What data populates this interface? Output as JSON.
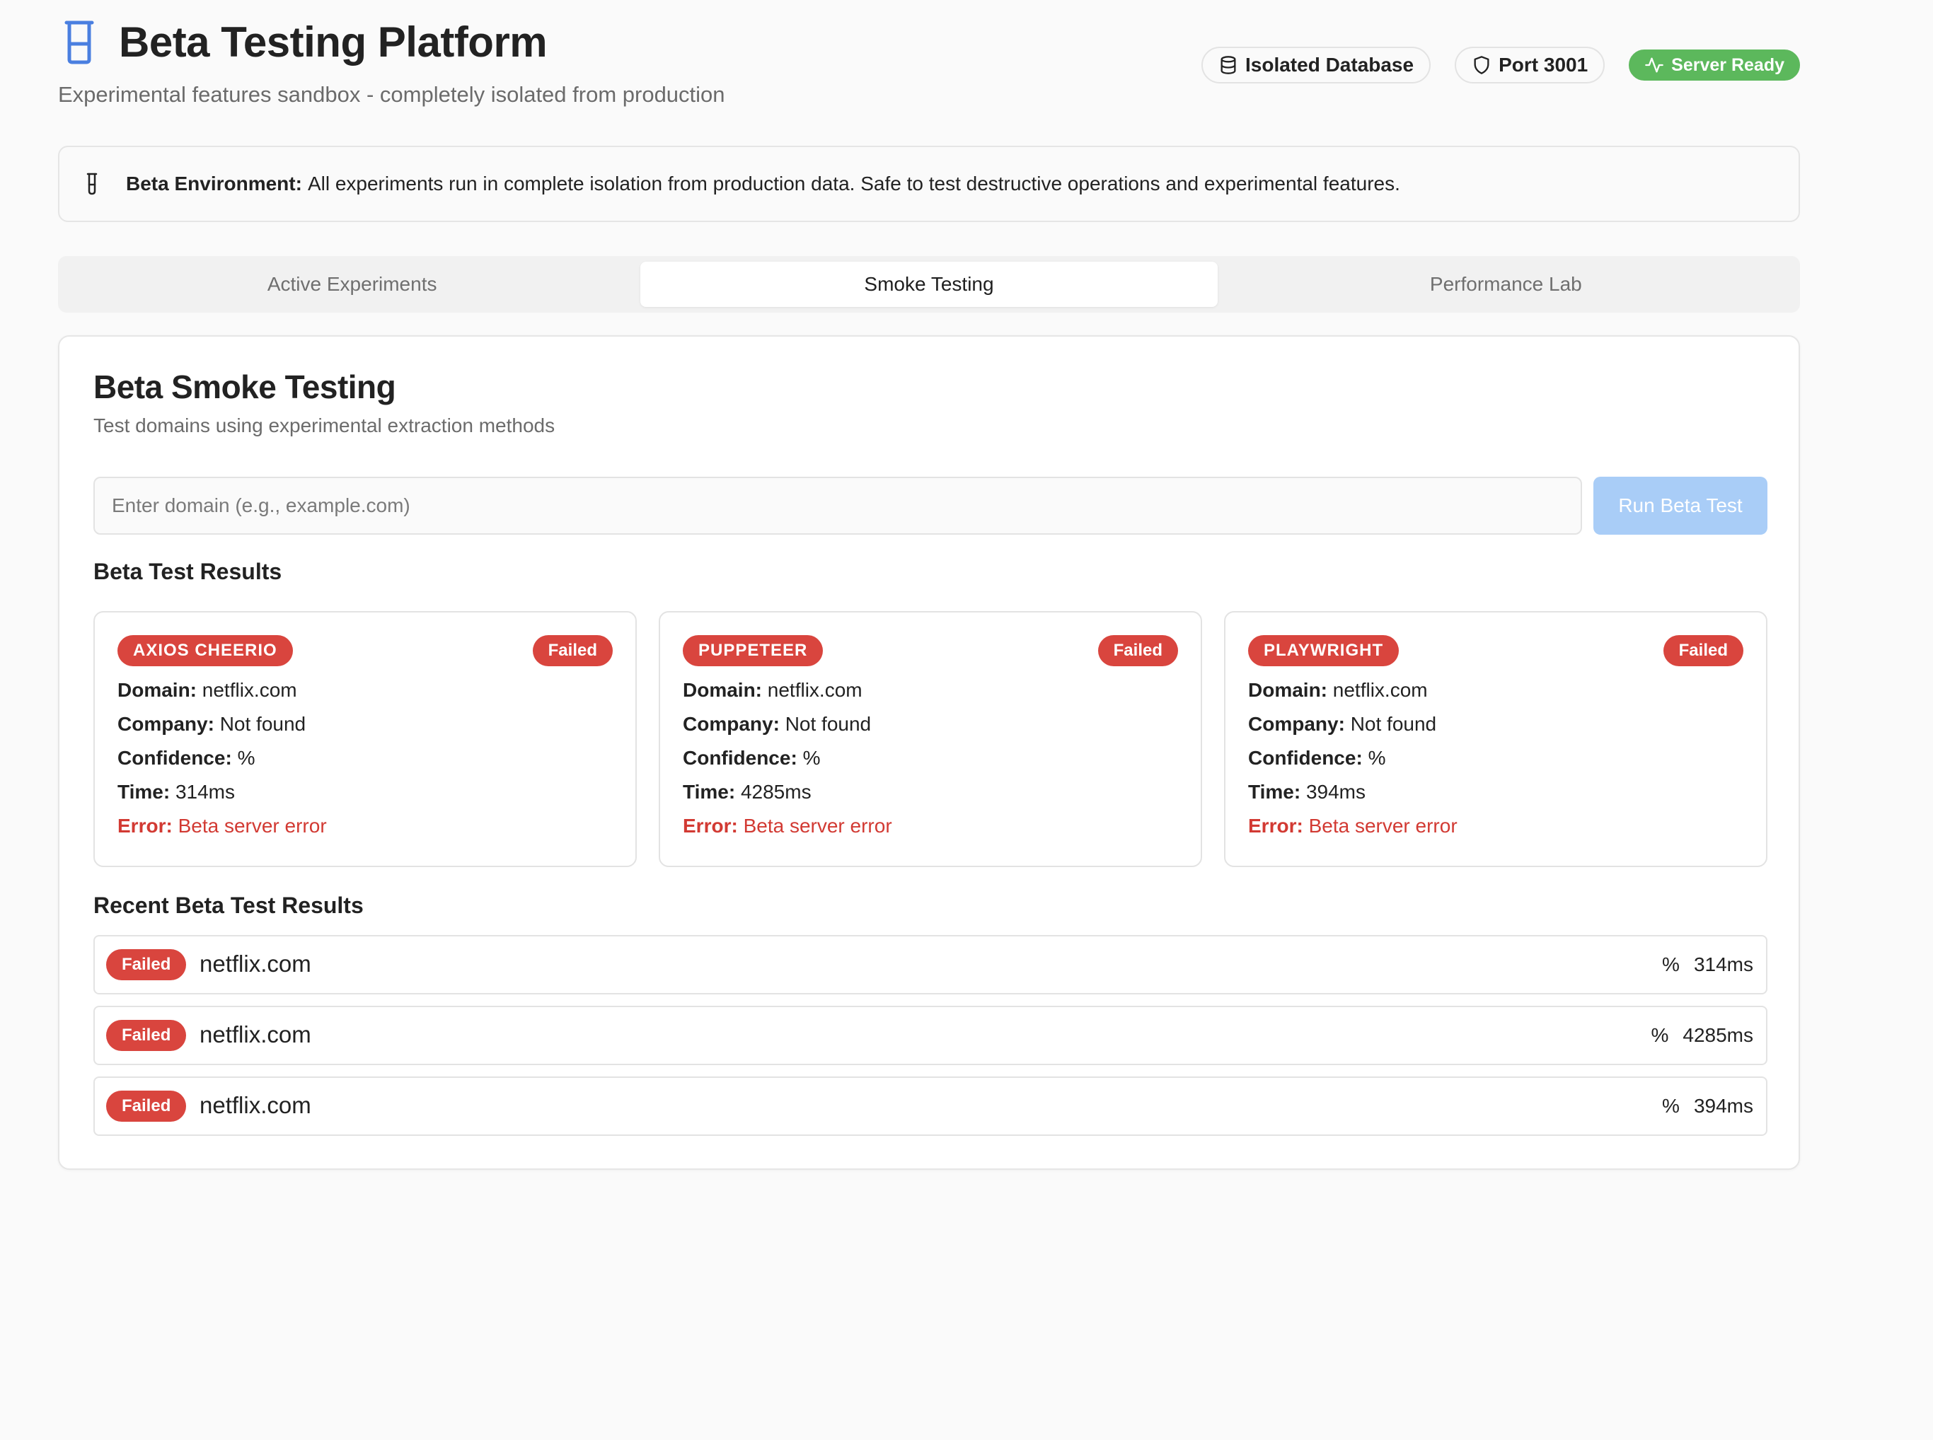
{
  "header": {
    "title": "Beta Testing Platform",
    "subtitle": "Experimental features sandbox - completely isolated from production",
    "logo_icon": "beaker-icon",
    "badges": {
      "database": "Isolated Database",
      "port": "Port 3001",
      "server": "Server Ready"
    }
  },
  "alert": {
    "icon": "test-tube-icon",
    "label": "Beta Environment:",
    "text": "All experiments run in complete isolation from production data. Safe to test destructive operations and experimental features."
  },
  "tabs": {
    "active_experiments": "Active Experiments",
    "smoke_testing": "Smoke Testing",
    "performance_lab": "Performance Lab",
    "selected": "Smoke Testing"
  },
  "smoke": {
    "title": "Beta Smoke Testing",
    "description": "Test domains using experimental extraction methods",
    "input_placeholder": "Enter domain (e.g., example.com)",
    "input_value": "",
    "run_button": "Run Beta Test",
    "results_title": "Beta Test Results",
    "recent_title": "Recent Beta Test Results"
  },
  "labels": {
    "domain": "Domain:",
    "company": "Company:",
    "confidence": "Confidence:",
    "time": "Time:",
    "error": "Error:"
  },
  "results": [
    {
      "method": "AXIOS CHEERIO",
      "status": "Failed",
      "domain": "netflix.com",
      "company": "Not found",
      "confidence": "%",
      "time": "314ms",
      "error": "Beta server error"
    },
    {
      "method": "PUPPETEER",
      "status": "Failed",
      "domain": "netflix.com",
      "company": "Not found",
      "confidence": "%",
      "time": "4285ms",
      "error": "Beta server error"
    },
    {
      "method": "PLAYWRIGHT",
      "status": "Failed",
      "domain": "netflix.com",
      "company": "Not found",
      "confidence": "%",
      "time": "394ms",
      "error": "Beta server error"
    }
  ],
  "recent": [
    {
      "status": "Failed",
      "domain": "netflix.com",
      "confidence": "%",
      "time": "314ms"
    },
    {
      "status": "Failed",
      "domain": "netflix.com",
      "confidence": "%",
      "time": "4285ms"
    },
    {
      "status": "Failed",
      "domain": "netflix.com",
      "confidence": "%",
      "time": "394ms"
    }
  ],
  "colors": {
    "accent_blue": "#3b82f6",
    "failed_red": "#d9453e",
    "error_text": "#d23a33",
    "ready_green": "#5cb85c",
    "button_disabled": "#a9cdf7"
  }
}
